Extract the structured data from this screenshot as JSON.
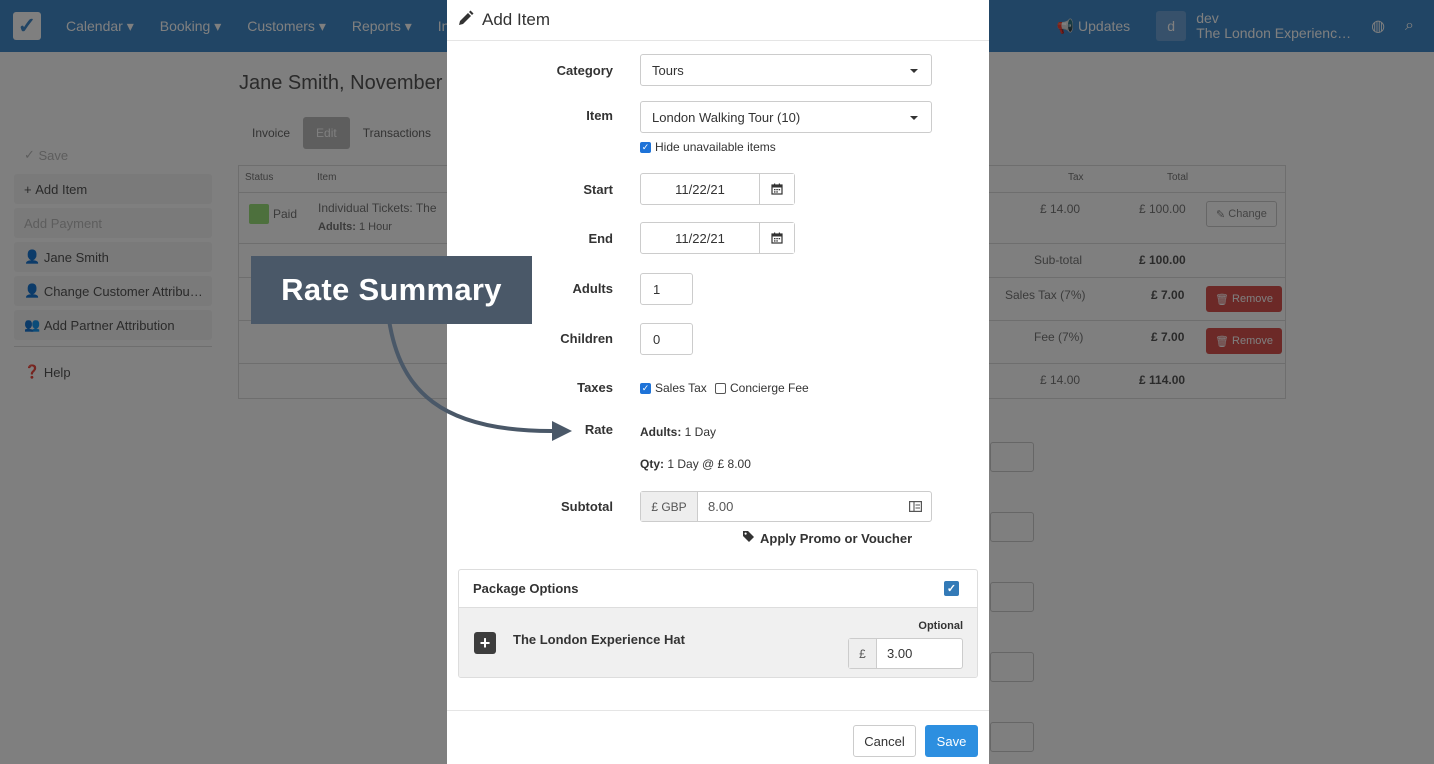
{
  "navbar": {
    "items": [
      "Calendar ▾",
      "Booking ▾",
      "Customers ▾",
      "Reports ▾",
      "Inv"
    ],
    "updates": "Updates",
    "user_initial": "d",
    "user_name": "dev",
    "user_company": "The London Experienc…"
  },
  "background": {
    "page_title": "Jane Smith, November",
    "tabs": [
      "Invoice",
      "Edit",
      "Transactions"
    ],
    "sidebar": [
      "Save",
      "Add Item",
      "Add Payment",
      "Jane Smith",
      "Change Customer Attribu…",
      "Add Partner Attribution",
      "Help"
    ],
    "table": {
      "headers": [
        "Status",
        "Item",
        "Tax",
        "Total"
      ],
      "status": "Paid",
      "item_line1": "Individual Tickets: The",
      "item_line2_label": "Adults:",
      "item_line2_value": "1 Hour",
      "row_tax": "£ 14.00",
      "row_total": "£ 100.00",
      "change_label": "Change",
      "subtotal_label": "Sub-total",
      "subtotal_value": "£ 100.00",
      "sales_tax_label": "Sales Tax (7%)",
      "sales_tax_value": "£ 7.00",
      "fee_label": "Fee (7%)",
      "fee_value": "£ 7.00",
      "remove_label": "Remove",
      "grand_tax": "£ 14.00",
      "grand_total": "£ 114.00"
    }
  },
  "modal": {
    "title": "Add Item",
    "category_label": "Category",
    "category_value": "Tours",
    "item_label": "Item",
    "item_value": "London Walking Tour (10)",
    "hide_unavailable": "Hide unavailable items",
    "start_label": "Start",
    "start_value": "11/22/21",
    "end_label": "End",
    "end_value": "11/22/21",
    "adults_label": "Adults",
    "adults_value": "1",
    "children_label": "Children",
    "children_value": "0",
    "taxes_label": "Taxes",
    "tax_sales": "Sales Tax",
    "tax_concierge": "Concierge Fee",
    "rate_label": "Rate",
    "rate_adults_key": "Adults:",
    "rate_adults_val": "1 Day",
    "rate_qty_key": "Qty:",
    "rate_qty_val": "1 Day @ £ 8.00",
    "subtotal_label": "Subtotal",
    "subtotal_currency": "£ GBP",
    "subtotal_value": "8.00",
    "promo": "Apply Promo or Voucher",
    "package_title": "Package Options",
    "package_item": "The London Experience Hat",
    "package_optional": "Optional",
    "package_currency": "£",
    "package_price": "3.00",
    "cancel": "Cancel",
    "save": "Save"
  },
  "callout": {
    "text": "Rate Summary",
    "color": "#4a5868"
  },
  "colors": {
    "primary": "#428bca",
    "save_button": "#2d8fe0",
    "remove_button": "#d9534f"
  }
}
